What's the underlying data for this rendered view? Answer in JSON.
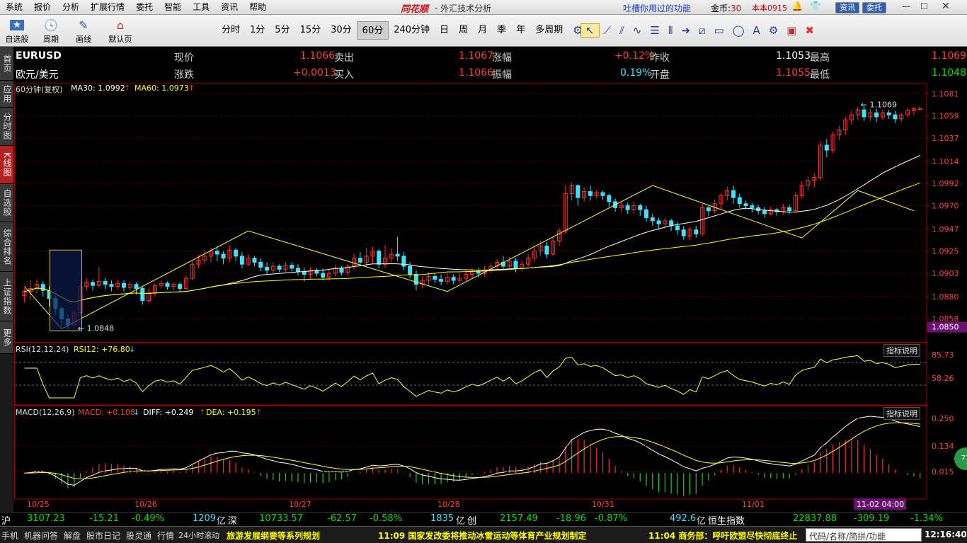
{
  "menu": {
    "items": [
      "系统",
      "报价",
      "分析",
      "扩展行情",
      "委托",
      "智能",
      "工具",
      "资讯",
      "帮助"
    ],
    "brand": "同花顺",
    "subtitle": "- 外汇技术分析",
    "feedback": "吐槽你用过的功能",
    "coins_label": "金币:",
    "coins_value": "30",
    "version": "本本0915",
    "news_btn": "资讯",
    "trade_btn": "委托"
  },
  "toolbar": {
    "self_stock": "自选股",
    "period_label": "周期",
    "draw": "画线",
    "default_page": "默认页",
    "periods": [
      "分时",
      "1分",
      "5分",
      "15分",
      "30分",
      "60分",
      "240分钟",
      "日",
      "周",
      "月",
      "季",
      "年",
      "多周期"
    ],
    "active_period": "60分"
  },
  "sidetabs": [
    "首页",
    "应用",
    "分时图",
    "K线图",
    "自选股",
    "综合排名",
    "上证指数",
    "更多"
  ],
  "info": {
    "code": "EURUSD",
    "name": "欧元/美元",
    "price_label": "现价",
    "price": "1.1066",
    "sell_label": "卖出",
    "sell": "1.1067",
    "chg_pct_label": "涨幅",
    "chg_pct": "+0.12%",
    "prev_close_label": "昨收",
    "prev_close": "1.1053",
    "high_label": "最高",
    "high": "1.1069",
    "change_label": "涨跌",
    "change": "+0.0013",
    "buy_label": "买入",
    "buy": "1.1066",
    "amplitude_label": "振幅",
    "amplitude": "0.19%",
    "open_label": "开盘",
    "open": "1.1055",
    "low_label": "最低",
    "low": "1.1048"
  },
  "indicators": {
    "main_label": "60分钟(复权)",
    "ma30": "MA30: 1.0992",
    "ma60": "MA60: 1.0973",
    "rsi_label": "RSI(12,12,24)",
    "rsi12": "RSI12: +76.80",
    "macd_label": "MACD(12,26,9)",
    "macd": "MACD: +0.108",
    "diff": "DIFF: +0.249",
    "dea": "DEA: +0.195",
    "explain": "指标说明"
  },
  "chart_data": {
    "type": "candlestick",
    "price_ticks": [
      "1.1081",
      "1.1059",
      "1.1037",
      "1.1014",
      "1.0992",
      "1.0970",
      "1.0947",
      "1.0925",
      "1.0903",
      "1.0880",
      "1.0858"
    ],
    "current_price_tag": "1.0850",
    "high_annotation": "1.1069",
    "low_annotation": "1.0848",
    "rsi_ticks": [
      "85.73",
      "58.26"
    ],
    "macd_ticks": [
      "0.250",
      "0.134",
      "0.015"
    ],
    "x_labels": [
      "10/25",
      "10/26",
      "10/27",
      "10/28",
      "10/31",
      "11/01"
    ],
    "cursor_time": "11-02 04:00",
    "ylim": [
      1.0842,
      1.1084
    ],
    "candles": [
      [
        1.0881,
        1.0885,
        1.0874,
        1.0888
      ],
      [
        1.0885,
        1.0888,
        1.0877,
        1.0896
      ],
      [
        1.0888,
        1.0892,
        1.0883,
        1.0897
      ],
      [
        1.0892,
        1.0886,
        1.088,
        1.0895
      ],
      [
        1.0886,
        1.0878,
        1.087,
        1.089
      ],
      [
        1.0878,
        1.0868,
        1.0862,
        1.0881
      ],
      [
        1.0868,
        1.0858,
        1.085,
        1.087
      ],
      [
        1.0858,
        1.0852,
        1.0848,
        1.0862
      ],
      [
        1.0852,
        1.0864,
        1.085,
        1.0866
      ],
      [
        1.0864,
        1.089,
        1.0862,
        1.0894
      ],
      [
        1.089,
        1.0894,
        1.0886,
        1.0898
      ],
      [
        1.0894,
        1.0891,
        1.0886,
        1.0897
      ],
      [
        1.0891,
        1.0895,
        1.0889,
        1.0909
      ],
      [
        1.0895,
        1.0892,
        1.0887,
        1.0898
      ],
      [
        1.0892,
        1.089,
        1.0885,
        1.0896
      ],
      [
        1.089,
        1.0893,
        1.0887,
        1.0897
      ],
      [
        1.0893,
        1.0889,
        1.0885,
        1.0896
      ],
      [
        1.0889,
        1.0892,
        1.0886,
        1.0895
      ],
      [
        1.0892,
        1.0888,
        1.0882,
        1.0894
      ],
      [
        1.0888,
        1.0876,
        1.0872,
        1.089
      ],
      [
        1.0876,
        1.0884,
        1.0874,
        1.0888
      ],
      [
        1.0884,
        1.0891,
        1.088,
        1.0893
      ],
      [
        1.0891,
        1.0893,
        1.0888,
        1.0896
      ],
      [
        1.0893,
        1.089,
        1.0887,
        1.0895
      ],
      [
        1.089,
        1.0892,
        1.0886,
        1.0894
      ],
      [
        1.0892,
        1.0888,
        1.0885,
        1.0894
      ],
      [
        1.0888,
        1.0898,
        1.0886,
        1.0901
      ],
      [
        1.0898,
        1.0912,
        1.0896,
        1.0915
      ],
      [
        1.0912,
        1.0916,
        1.0908,
        1.0921
      ],
      [
        1.0916,
        1.092,
        1.0912,
        1.0926
      ],
      [
        1.092,
        1.0925,
        1.0914,
        1.0928
      ],
      [
        1.0925,
        1.0922,
        1.0915,
        1.093
      ],
      [
        1.0922,
        1.0918,
        1.0912,
        1.0925
      ],
      [
        1.0918,
        1.0926,
        1.0914,
        1.0931
      ],
      [
        1.0926,
        1.092,
        1.0915,
        1.0928
      ],
      [
        1.092,
        1.0912,
        1.0908,
        1.0924
      ],
      [
        1.0912,
        1.0918,
        1.091,
        1.0922
      ],
      [
        1.0918,
        1.0914,
        1.091,
        1.092
      ],
      [
        1.0914,
        1.0909,
        1.0905,
        1.0918
      ],
      [
        1.0909,
        1.0906,
        1.0902,
        1.0914
      ],
      [
        1.0906,
        1.091,
        1.0903,
        1.0914
      ],
      [
        1.091,
        1.0907,
        1.0904,
        1.0912
      ],
      [
        1.0907,
        1.0911,
        1.0904,
        1.0914
      ],
      [
        1.0911,
        1.0908,
        1.0905,
        1.0914
      ],
      [
        1.0908,
        1.0905,
        1.0901,
        1.0912
      ],
      [
        1.0905,
        1.0902,
        1.0895,
        1.0909
      ],
      [
        1.0902,
        1.0906,
        1.0897,
        1.0909
      ],
      [
        1.0906,
        1.0903,
        1.09,
        1.0908
      ],
      [
        1.0903,
        1.0899,
        1.0896,
        1.0908
      ],
      [
        1.0899,
        1.0903,
        1.0896,
        1.0906
      ],
      [
        1.0903,
        1.0908,
        1.09,
        1.0911
      ],
      [
        1.0908,
        1.0904,
        1.0901,
        1.091
      ],
      [
        1.0904,
        1.091,
        1.09,
        1.0912
      ],
      [
        1.091,
        1.0918,
        1.0907,
        1.0922
      ],
      [
        1.0918,
        1.0914,
        1.091,
        1.0924
      ],
      [
        1.0914,
        1.092,
        1.091,
        1.0928
      ],
      [
        1.092,
        1.0925,
        1.0912,
        1.0929
      ],
      [
        1.0925,
        1.0912,
        1.0908,
        1.0927
      ],
      [
        1.0912,
        1.0918,
        1.0908,
        1.0931
      ],
      [
        1.0918,
        1.0922,
        1.0914,
        1.0928
      ],
      [
        1.0922,
        1.092,
        1.0915,
        1.0939
      ],
      [
        1.092,
        1.091,
        1.0906,
        1.0924
      ],
      [
        1.091,
        1.0902,
        1.0898,
        1.0914
      ],
      [
        1.0902,
        1.0892,
        1.0886,
        1.0906
      ],
      [
        1.0892,
        1.0896,
        1.0888,
        1.09
      ],
      [
        1.0896,
        1.09,
        1.0892,
        1.0904
      ],
      [
        1.09,
        1.0897,
        1.0893,
        1.0903
      ],
      [
        1.0897,
        1.0895,
        1.0891,
        1.0902
      ],
      [
        1.0895,
        1.0899,
        1.0892,
        1.0903
      ],
      [
        1.0899,
        1.0896,
        1.0892,
        1.0902
      ],
      [
        1.0896,
        1.0898,
        1.0893,
        1.0903
      ],
      [
        1.0898,
        1.0902,
        1.0895,
        1.0906
      ],
      [
        1.0902,
        1.0905,
        1.0898,
        1.0908
      ],
      [
        1.0905,
        1.0903,
        1.0899,
        1.0908
      ],
      [
        1.0903,
        1.0906,
        1.09,
        1.091
      ],
      [
        1.0906,
        1.091,
        1.0903,
        1.0913
      ],
      [
        1.091,
        1.0914,
        1.0906,
        1.0917
      ],
      [
        1.0914,
        1.091,
        1.0906,
        1.092
      ],
      [
        1.091,
        1.0915,
        1.0907,
        1.0919
      ],
      [
        1.0915,
        1.0908,
        1.0904,
        1.0918
      ],
      [
        1.0908,
        1.0912,
        1.0905,
        1.0916
      ],
      [
        1.0912,
        1.0918,
        1.0909,
        1.0922
      ],
      [
        1.0918,
        1.0925,
        1.0914,
        1.093
      ],
      [
        1.0925,
        1.093,
        1.092,
        1.0935
      ],
      [
        1.093,
        1.0922,
        1.0918,
        1.0934
      ],
      [
        1.0922,
        1.0935,
        1.092,
        1.094
      ],
      [
        1.0935,
        1.0945,
        1.093,
        1.0948
      ],
      [
        1.0945,
        1.0982,
        1.0942,
        1.099
      ],
      [
        1.0982,
        1.099,
        1.0975,
        1.0993
      ],
      [
        1.099,
        1.0978,
        1.097,
        1.0991
      ],
      [
        1.0978,
        1.0984,
        1.0974,
        1.0988
      ],
      [
        1.0984,
        1.098,
        1.0975,
        1.099
      ],
      [
        1.098,
        1.0983,
        1.0977,
        1.0986
      ],
      [
        1.0983,
        1.098,
        1.0976,
        1.0985
      ],
      [
        1.098,
        1.0974,
        1.0969,
        1.0982
      ],
      [
        1.0974,
        1.0968,
        1.0964,
        1.0977
      ],
      [
        1.0968,
        1.097,
        1.0963,
        1.0974
      ],
      [
        1.097,
        1.0966,
        1.0962,
        1.0973
      ],
      [
        1.0966,
        1.097,
        1.0962,
        1.0974
      ],
      [
        1.097,
        1.0966,
        1.096,
        1.0972
      ],
      [
        1.0966,
        1.0958,
        1.0954,
        1.097
      ],
      [
        1.0958,
        1.0955,
        1.095,
        1.0962
      ],
      [
        1.0955,
        1.0952,
        1.0946,
        1.0958
      ],
      [
        1.0952,
        1.0955,
        1.0948,
        1.0958
      ],
      [
        1.0955,
        1.095,
        1.0945,
        1.0957
      ],
      [
        1.095,
        1.0946,
        1.0941,
        1.0954
      ],
      [
        1.0946,
        1.094,
        1.0936,
        1.095
      ],
      [
        1.094,
        1.0946,
        1.0936,
        1.0949
      ],
      [
        1.0946,
        1.0942,
        1.0938,
        1.095
      ],
      [
        1.0942,
        1.0968,
        1.094,
        1.0972
      ],
      [
        1.0968,
        1.0965,
        1.096,
        1.097
      ],
      [
        1.0965,
        1.0972,
        1.0962,
        1.0976
      ],
      [
        1.0972,
        1.098,
        1.0966,
        1.0982
      ],
      [
        1.098,
        1.0985,
        1.0975,
        1.0989
      ],
      [
        1.0985,
        1.0978,
        1.0972,
        1.099
      ],
      [
        1.0978,
        1.0972,
        1.0968,
        1.0982
      ],
      [
        1.0972,
        1.097,
        1.0966,
        1.0975
      ],
      [
        1.097,
        1.0968,
        1.0963,
        1.0973
      ],
      [
        1.0968,
        1.0965,
        1.0961,
        1.0971
      ],
      [
        1.0965,
        1.0962,
        1.0958,
        1.0969
      ],
      [
        1.0962,
        1.0966,
        1.096,
        1.0969
      ],
      [
        1.0966,
        1.0964,
        1.096,
        1.0968
      ],
      [
        1.0964,
        1.0968,
        1.0961,
        1.0972
      ],
      [
        1.0968,
        1.0965,
        1.0962,
        1.0971
      ],
      [
        1.0965,
        1.098,
        1.0963,
        1.0983
      ],
      [
        1.098,
        1.099,
        1.0977,
        1.0994
      ],
      [
        1.099,
        1.0995,
        1.0985,
        1.0999
      ],
      [
        1.0995,
        1.0998,
        1.0988,
        1.1002
      ],
      [
        1.0998,
        1.103,
        1.0995,
        1.1034
      ],
      [
        1.103,
        1.1025,
        1.1018,
        1.1036
      ],
      [
        1.1025,
        1.104,
        1.1022,
        1.1043
      ],
      [
        1.104,
        1.1045,
        1.1035,
        1.1049
      ],
      [
        1.1045,
        1.1055,
        1.104,
        1.1058
      ],
      [
        1.1055,
        1.106,
        1.105,
        1.1064
      ],
      [
        1.106,
        1.1065,
        1.1055,
        1.1068
      ],
      [
        1.1065,
        1.1058,
        1.1054,
        1.1069
      ],
      [
        1.1058,
        1.1062,
        1.1054,
        1.1066
      ],
      [
        1.1062,
        1.1058,
        1.1053,
        1.1066
      ],
      [
        1.1058,
        1.1062,
        1.1055,
        1.1065
      ],
      [
        1.1062,
        1.106,
        1.1056,
        1.1065
      ],
      [
        1.106,
        1.1056,
        1.1052,
        1.1064
      ],
      [
        1.1056,
        1.106,
        1.1053,
        1.1062
      ],
      [
        1.106,
        1.1064,
        1.1057,
        1.1067
      ],
      [
        1.1064,
        1.1066,
        1.106,
        1.1068
      ],
      [
        1.1066,
        1.1066,
        1.1064,
        1.1069
      ]
    ]
  },
  "bottom": {
    "sh_label": "沪",
    "sh_val": "3107.23",
    "sh_chg": "-15.21",
    "sh_pct": "-0.49%",
    "sh_amt": "1209",
    "sh_unit": "亿",
    "sz_label": "深",
    "sz_val": "10733.57",
    "sz_chg": "-62.57",
    "sz_pct": "-0.58%",
    "sz_amt": "1835",
    "sz_unit": "亿",
    "cy_label": "创",
    "cy_val": "2157.49",
    "cy_chg": "-18.96",
    "cy_pct": "-0.87%",
    "cy_amt": "492.6",
    "cy_unit": "亿",
    "hs_label": "恒生指数",
    "hs_val": "22837.88",
    "hs_chg": "-309.19",
    "hs_pct": "-1.34%"
  },
  "status": {
    "tabs": [
      "手机",
      "机器问答",
      "解盘",
      "股市日记",
      "股灵通",
      "行情",
      "24小时滚动"
    ],
    "news1": "旅游发展纲要等系列规划",
    "news2": "11:09 国家发改委将推动冰雪运动等体育产业规划制定",
    "news3": "11:04 商务部：呼吁欧盟尽快彻底终止",
    "search": "代码/名称/简拼/功能",
    "clock": "12:16:40"
  }
}
